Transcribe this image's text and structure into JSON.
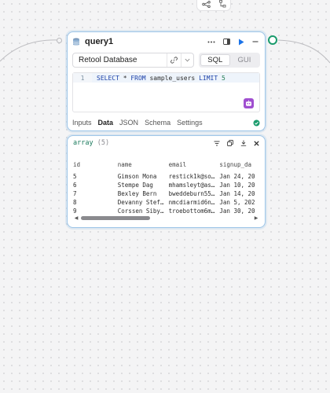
{
  "query": {
    "name": "query1",
    "resource": "Retool Database",
    "modes": [
      "SQL",
      "GUI"
    ],
    "active_mode": "SQL",
    "line_number": "1",
    "code": {
      "select": "SELECT",
      "star": " * ",
      "from": "FROM",
      "table": " sample_users ",
      "limit": "LIMIT",
      "limit_value": " 5"
    },
    "tabs": [
      "Inputs",
      "Data",
      "JSON",
      "Schema",
      "Settings"
    ],
    "active_tab": "Data"
  },
  "result": {
    "type_label": "array",
    "count_label": "(5)",
    "columns": [
      "id",
      "name",
      "email",
      "signup_da"
    ],
    "rows": [
      [
        "5",
        "Gimson Mona",
        "restick1k@so…",
        "Jan 24, 20"
      ],
      [
        "6",
        "Stempe Dag",
        "mhamsleyt@as…",
        "Jan 10, 20"
      ],
      [
        "7",
        "Bexley Bern",
        "bweddeburn55…",
        "Jan 14, 20"
      ],
      [
        "8",
        "Devanny Stef…",
        "nmcdiarmid6n…",
        "Jan 5, 202"
      ],
      [
        "9",
        "Corssen Siby…",
        "troebottom6m…",
        "Jan 30, 20"
      ]
    ],
    "scroll_position": 0.4
  },
  "colors": {
    "accent": "#1a73e8",
    "success": "#1a9b6c",
    "card_border": "#9dc5e8",
    "assist": "#a04fd0"
  },
  "icons": [
    "share-icon",
    "hierarchy-icon",
    "database-icon",
    "more-icon",
    "panel-icon",
    "run-icon",
    "link-icon",
    "chevron-down-icon",
    "assist-icon",
    "check-circle-icon",
    "filter-icon",
    "copy-icon",
    "download-icon",
    "close-icon"
  ]
}
